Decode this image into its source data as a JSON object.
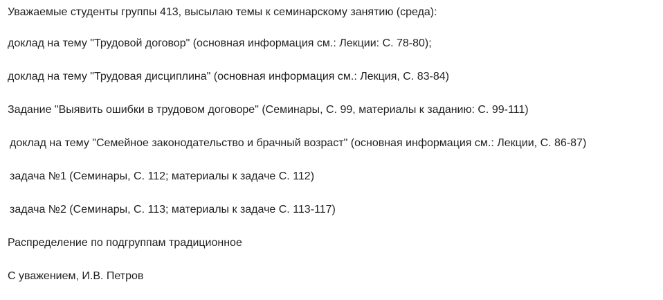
{
  "message": {
    "greeting": "Уважаемые студенты группы 413, высылаю темы к семинарскому занятию (среда):",
    "items": [
      "доклад на тему \"Трудовой договор\" (основная информация см.: Лекции: С. 78-80);",
      "доклад на тему \"Трудовая дисциплина\" (основная информация см.: Лекция, С. 83-84)",
      "Задание \"Выявить ошибки в трудовом договоре\" (Семинары, С. 99, материалы к заданию: С. 99-111)",
      "доклад на тему \"Семейное законодательство и брачный возраст\" (основная информация см.: Лекции, С. 86-87)",
      "задача №1 (Семинары, С. 112; материалы к задаче С. 112)",
      "задача №2 (Семинары, С. 113; материалы к задаче С. 113-117)"
    ],
    "note": "Распределение по подгруппам традиционное",
    "signature": "С уважением, И.В. Петров"
  }
}
